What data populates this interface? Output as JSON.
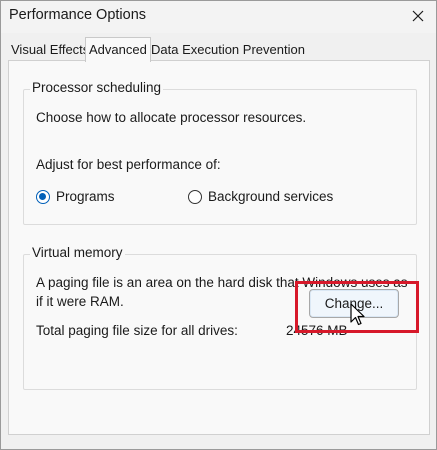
{
  "window": {
    "title": "Performance Options"
  },
  "tabs": [
    {
      "label": "Visual Effects",
      "active": false
    },
    {
      "label": "Advanced",
      "active": true
    },
    {
      "label": "Data Execution Prevention",
      "active": false
    }
  ],
  "processor_scheduling": {
    "legend": "Processor scheduling",
    "description": "Choose how to allocate processor resources.",
    "adjust_label": "Adjust for best performance of:",
    "options": [
      {
        "label": "Programs",
        "checked": true
      },
      {
        "label": "Background services",
        "checked": false
      }
    ]
  },
  "virtual_memory": {
    "legend": "Virtual memory",
    "description_line1": "A paging file is an area on the hard disk that Windows uses as",
    "description_line2": "if it were RAM.",
    "total_label": "Total paging file size for all drives:",
    "total_value": "24576 MB",
    "change_button": "Change..."
  },
  "colors": {
    "accent": "#005fb8",
    "highlight": "#d7192a"
  }
}
